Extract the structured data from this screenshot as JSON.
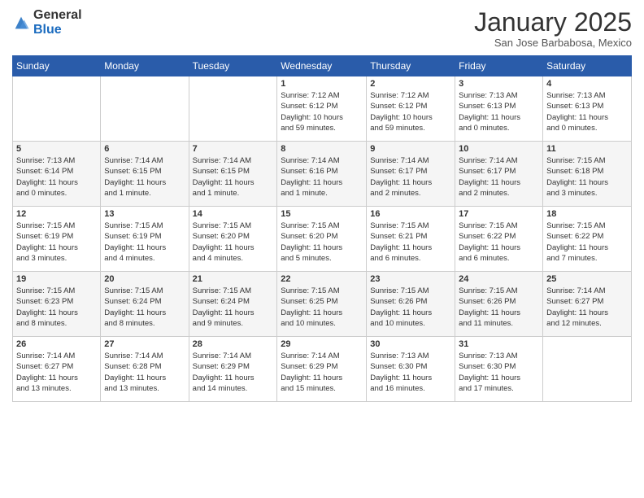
{
  "logo": {
    "general": "General",
    "blue": "Blue"
  },
  "title": "January 2025",
  "location": "San Jose Barbabosa, Mexico",
  "days_header": [
    "Sunday",
    "Monday",
    "Tuesday",
    "Wednesday",
    "Thursday",
    "Friday",
    "Saturday"
  ],
  "weeks": [
    [
      {
        "day": "",
        "info": ""
      },
      {
        "day": "",
        "info": ""
      },
      {
        "day": "",
        "info": ""
      },
      {
        "day": "1",
        "info": "Sunrise: 7:12 AM\nSunset: 6:12 PM\nDaylight: 10 hours\nand 59 minutes."
      },
      {
        "day": "2",
        "info": "Sunrise: 7:12 AM\nSunset: 6:12 PM\nDaylight: 10 hours\nand 59 minutes."
      },
      {
        "day": "3",
        "info": "Sunrise: 7:13 AM\nSunset: 6:13 PM\nDaylight: 11 hours\nand 0 minutes."
      },
      {
        "day": "4",
        "info": "Sunrise: 7:13 AM\nSunset: 6:13 PM\nDaylight: 11 hours\nand 0 minutes."
      }
    ],
    [
      {
        "day": "5",
        "info": "Sunrise: 7:13 AM\nSunset: 6:14 PM\nDaylight: 11 hours\nand 0 minutes."
      },
      {
        "day": "6",
        "info": "Sunrise: 7:14 AM\nSunset: 6:15 PM\nDaylight: 11 hours\nand 1 minute."
      },
      {
        "day": "7",
        "info": "Sunrise: 7:14 AM\nSunset: 6:15 PM\nDaylight: 11 hours\nand 1 minute."
      },
      {
        "day": "8",
        "info": "Sunrise: 7:14 AM\nSunset: 6:16 PM\nDaylight: 11 hours\nand 1 minute."
      },
      {
        "day": "9",
        "info": "Sunrise: 7:14 AM\nSunset: 6:17 PM\nDaylight: 11 hours\nand 2 minutes."
      },
      {
        "day": "10",
        "info": "Sunrise: 7:14 AM\nSunset: 6:17 PM\nDaylight: 11 hours\nand 2 minutes."
      },
      {
        "day": "11",
        "info": "Sunrise: 7:15 AM\nSunset: 6:18 PM\nDaylight: 11 hours\nand 3 minutes."
      }
    ],
    [
      {
        "day": "12",
        "info": "Sunrise: 7:15 AM\nSunset: 6:19 PM\nDaylight: 11 hours\nand 3 minutes."
      },
      {
        "day": "13",
        "info": "Sunrise: 7:15 AM\nSunset: 6:19 PM\nDaylight: 11 hours\nand 4 minutes."
      },
      {
        "day": "14",
        "info": "Sunrise: 7:15 AM\nSunset: 6:20 PM\nDaylight: 11 hours\nand 4 minutes."
      },
      {
        "day": "15",
        "info": "Sunrise: 7:15 AM\nSunset: 6:20 PM\nDaylight: 11 hours\nand 5 minutes."
      },
      {
        "day": "16",
        "info": "Sunrise: 7:15 AM\nSunset: 6:21 PM\nDaylight: 11 hours\nand 6 minutes."
      },
      {
        "day": "17",
        "info": "Sunrise: 7:15 AM\nSunset: 6:22 PM\nDaylight: 11 hours\nand 6 minutes."
      },
      {
        "day": "18",
        "info": "Sunrise: 7:15 AM\nSunset: 6:22 PM\nDaylight: 11 hours\nand 7 minutes."
      }
    ],
    [
      {
        "day": "19",
        "info": "Sunrise: 7:15 AM\nSunset: 6:23 PM\nDaylight: 11 hours\nand 8 minutes."
      },
      {
        "day": "20",
        "info": "Sunrise: 7:15 AM\nSunset: 6:24 PM\nDaylight: 11 hours\nand 8 minutes."
      },
      {
        "day": "21",
        "info": "Sunrise: 7:15 AM\nSunset: 6:24 PM\nDaylight: 11 hours\nand 9 minutes."
      },
      {
        "day": "22",
        "info": "Sunrise: 7:15 AM\nSunset: 6:25 PM\nDaylight: 11 hours\nand 10 minutes."
      },
      {
        "day": "23",
        "info": "Sunrise: 7:15 AM\nSunset: 6:26 PM\nDaylight: 11 hours\nand 10 minutes."
      },
      {
        "day": "24",
        "info": "Sunrise: 7:15 AM\nSunset: 6:26 PM\nDaylight: 11 hours\nand 11 minutes."
      },
      {
        "day": "25",
        "info": "Sunrise: 7:14 AM\nSunset: 6:27 PM\nDaylight: 11 hours\nand 12 minutes."
      }
    ],
    [
      {
        "day": "26",
        "info": "Sunrise: 7:14 AM\nSunset: 6:27 PM\nDaylight: 11 hours\nand 13 minutes."
      },
      {
        "day": "27",
        "info": "Sunrise: 7:14 AM\nSunset: 6:28 PM\nDaylight: 11 hours\nand 13 minutes."
      },
      {
        "day": "28",
        "info": "Sunrise: 7:14 AM\nSunset: 6:29 PM\nDaylight: 11 hours\nand 14 minutes."
      },
      {
        "day": "29",
        "info": "Sunrise: 7:14 AM\nSunset: 6:29 PM\nDaylight: 11 hours\nand 15 minutes."
      },
      {
        "day": "30",
        "info": "Sunrise: 7:13 AM\nSunset: 6:30 PM\nDaylight: 11 hours\nand 16 minutes."
      },
      {
        "day": "31",
        "info": "Sunrise: 7:13 AM\nSunset: 6:30 PM\nDaylight: 11 hours\nand 17 minutes."
      },
      {
        "day": "",
        "info": ""
      }
    ]
  ]
}
